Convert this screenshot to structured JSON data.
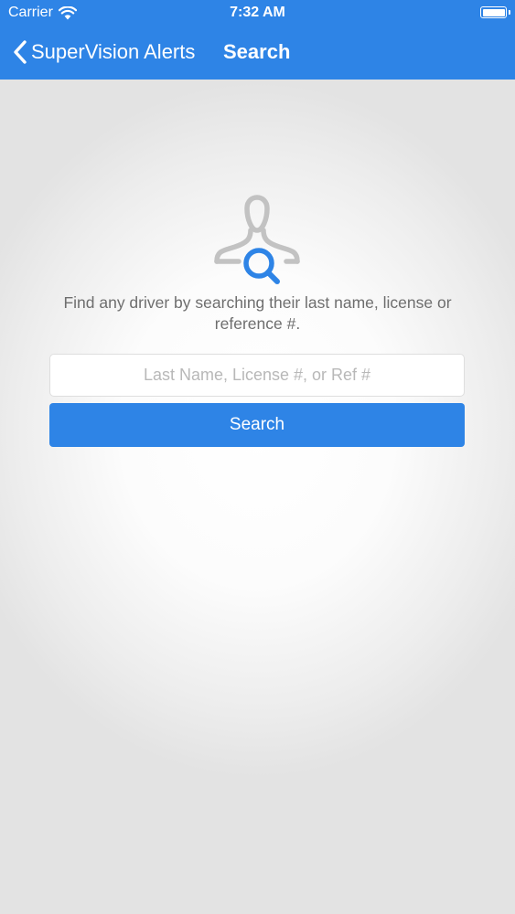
{
  "status_bar": {
    "carrier": "Carrier",
    "time": "7:32 AM",
    "battery_level_percent": 100
  },
  "nav_bar": {
    "back_label": "SuperVision Alerts",
    "title": "Search"
  },
  "search": {
    "description": "Find any driver by searching their last name, license or reference #.",
    "input_placeholder": "Last Name, License #, or Ref #",
    "input_value": "",
    "button_label": "Search"
  },
  "icons": {
    "wifi": "wifi-icon",
    "battery": "battery-icon",
    "back": "chevron-left-icon",
    "driver_search": "person-search-icon"
  },
  "colors": {
    "brand_blue": "#2e84e6",
    "text_gray": "#6e6e6e",
    "placeholder_gray": "#b8b8b8",
    "icon_gray": "#c2c2c2",
    "background": "#e3e3e3"
  }
}
